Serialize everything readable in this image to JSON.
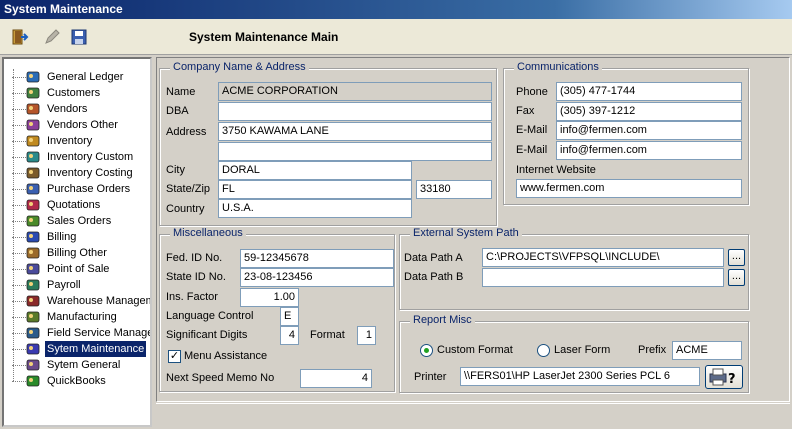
{
  "window": {
    "title": "System Maintenance"
  },
  "toolbar": {
    "heading": "System Maintenance Main",
    "buttons": [
      "exit-icon",
      "edit-icon",
      "save-icon"
    ]
  },
  "tree": {
    "selected": "Sytem Maintenance",
    "items": [
      {
        "label": "General Ledger",
        "icon": "general-ledger-icon"
      },
      {
        "label": "Customers",
        "icon": "customers-icon"
      },
      {
        "label": "Vendors",
        "icon": "vendors-icon"
      },
      {
        "label": "Vendors Other",
        "icon": "vendors-other-icon"
      },
      {
        "label": "Inventory",
        "icon": "inventory-icon"
      },
      {
        "label": "Inventory Custom",
        "icon": "inventory-custom-icon"
      },
      {
        "label": "Inventory Costing",
        "icon": "inventory-costing-icon"
      },
      {
        "label": "Purchase Orders",
        "icon": "purchase-orders-icon"
      },
      {
        "label": "Quotations",
        "icon": "quotations-icon"
      },
      {
        "label": "Sales Orders",
        "icon": "sales-orders-icon"
      },
      {
        "label": "Billing",
        "icon": "billing-icon"
      },
      {
        "label": "Billing Other",
        "icon": "billing-other-icon"
      },
      {
        "label": "Point of Sale",
        "icon": "point-of-sale-icon"
      },
      {
        "label": "Payroll",
        "icon": "payroll-icon"
      },
      {
        "label": "Warehouse Managem",
        "icon": "warehouse-icon"
      },
      {
        "label": "Manufacturing",
        "icon": "manufacturing-icon"
      },
      {
        "label": "Field Service Manage",
        "icon": "field-service-icon"
      },
      {
        "label": "Sytem Maintenance",
        "icon": "system-maintenance-icon"
      },
      {
        "label": "Sytem General",
        "icon": "system-general-icon"
      },
      {
        "label": "QuickBooks",
        "icon": "quickbooks-icon"
      }
    ]
  },
  "company": {
    "legend": "Company Name & Address",
    "name_label": "Name",
    "name": "ACME CORPORATION",
    "dba_label": "DBA",
    "dba": "",
    "address_label": "Address",
    "address1": "3750 KAWAMA LANE",
    "address2": "",
    "city_label": "City",
    "city": "DORAL",
    "statezip_label": "State/Zip",
    "state": "FL",
    "zip": "33180",
    "country_label": "Country",
    "country": "U.S.A."
  },
  "communications": {
    "legend": "Communications",
    "phone_label": "Phone",
    "phone": "(305) 477-1744",
    "fax_label": "Fax",
    "fax": "(305) 397-1212",
    "email1_label": "E-Mail",
    "email1": "info@fermen.com",
    "email2_label": "E-Mail",
    "email2": "info@fermen.com",
    "website_label": "Internet Website",
    "website": "www.fermen.com"
  },
  "misc": {
    "legend": "Miscellaneous",
    "fedid_label": "Fed. ID No.",
    "fedid": "59-12345678",
    "stateid_label": "State ID No.",
    "stateid": "23-08-123456",
    "insfactor_label": "Ins. Factor",
    "insfactor": "1.00",
    "langctrl_label": "Language Control",
    "langctrl": "E",
    "sigdigits_label": "Significant Digits",
    "sigdigits": "4",
    "format_label": "Format",
    "format": "1",
    "menu_assist_label": "Menu Assistance",
    "menu_assist_checked": true,
    "speedmemo_label": "Next Speed Memo No",
    "speedmemo": "4"
  },
  "external": {
    "legend": "External System Path",
    "path_a_label": "Data Path A",
    "path_a": "C:\\PROJECTS\\VFPSQL\\INCLUDE\\",
    "path_b_label": "Data Path B",
    "path_b": "",
    "browse_label": "..."
  },
  "report": {
    "legend": "Report Misc",
    "custom_format_label": "Custom Format",
    "laser_form_label": "Laser Form",
    "selected_format": "Custom Format",
    "prefix_label": "Prefix",
    "prefix": "ACME",
    "printer_label": "Printer",
    "printer": "\\\\FERS01\\HP LaserJet 2300 Series PCL 6"
  }
}
